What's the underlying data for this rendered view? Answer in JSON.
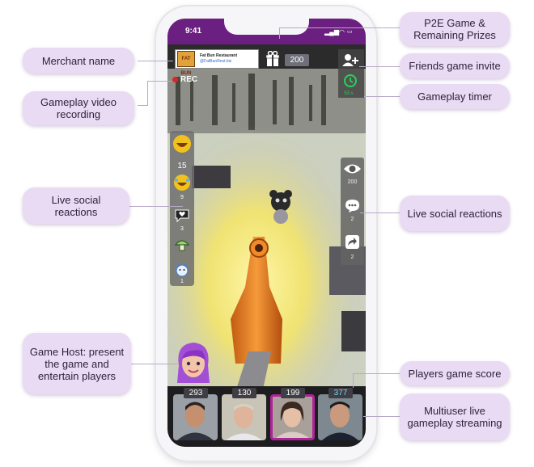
{
  "callouts": {
    "merchant_name": "Merchant name",
    "gameplay_video_recording": "Gameplay video recording",
    "live_social_reactions_left": "Live social reactions",
    "game_host": "Game Host: present the game and entertain players",
    "p2e_game_prizes": "P2E Game & Remaining Prizes",
    "friends_game_invite": "Friends game invite",
    "gameplay_timer": "Gameplay timer",
    "live_social_reactions_right": "Live social reactions",
    "players_game_score": "Players game score",
    "multiuser_live_streaming": "Multiuser live gameplay streaming"
  },
  "status_bar": {
    "time": "9:41"
  },
  "game": {
    "merchant": {
      "logo_text": "FAT BUN",
      "name": "Fat Bun Restaurant",
      "handle": "@FatBunRest.biz"
    },
    "prizes_remaining": "200",
    "rec_label": "REC",
    "timer": "53 s",
    "left_reactions": [
      {
        "icon": "laughing-emoji-icon",
        "count": "15"
      },
      {
        "icon": "crying-laugh-emoji-icon",
        "count": "9"
      },
      {
        "icon": "heart-bubble-icon",
        "count": "3"
      },
      {
        "icon": "mushroom-icon",
        "count": ""
      },
      {
        "icon": "cat-icon",
        "count": "1"
      }
    ],
    "right_reactions": [
      {
        "icon": "eye-icon",
        "count": "200"
      },
      {
        "icon": "comment-icon",
        "count": "2"
      },
      {
        "icon": "share-icon",
        "count": "2"
      }
    ],
    "players": [
      {
        "score": "293",
        "active": false
      },
      {
        "score": "130",
        "active": false
      },
      {
        "score": "199",
        "active": true
      },
      {
        "score": "377",
        "active": false
      }
    ]
  },
  "colors": {
    "status_bar": "#6b1f80",
    "callout_bg": "#e9dbf3",
    "active_player_border": "#b0249a",
    "timer_green": "#28d05a",
    "rec_red": "#e02424"
  }
}
